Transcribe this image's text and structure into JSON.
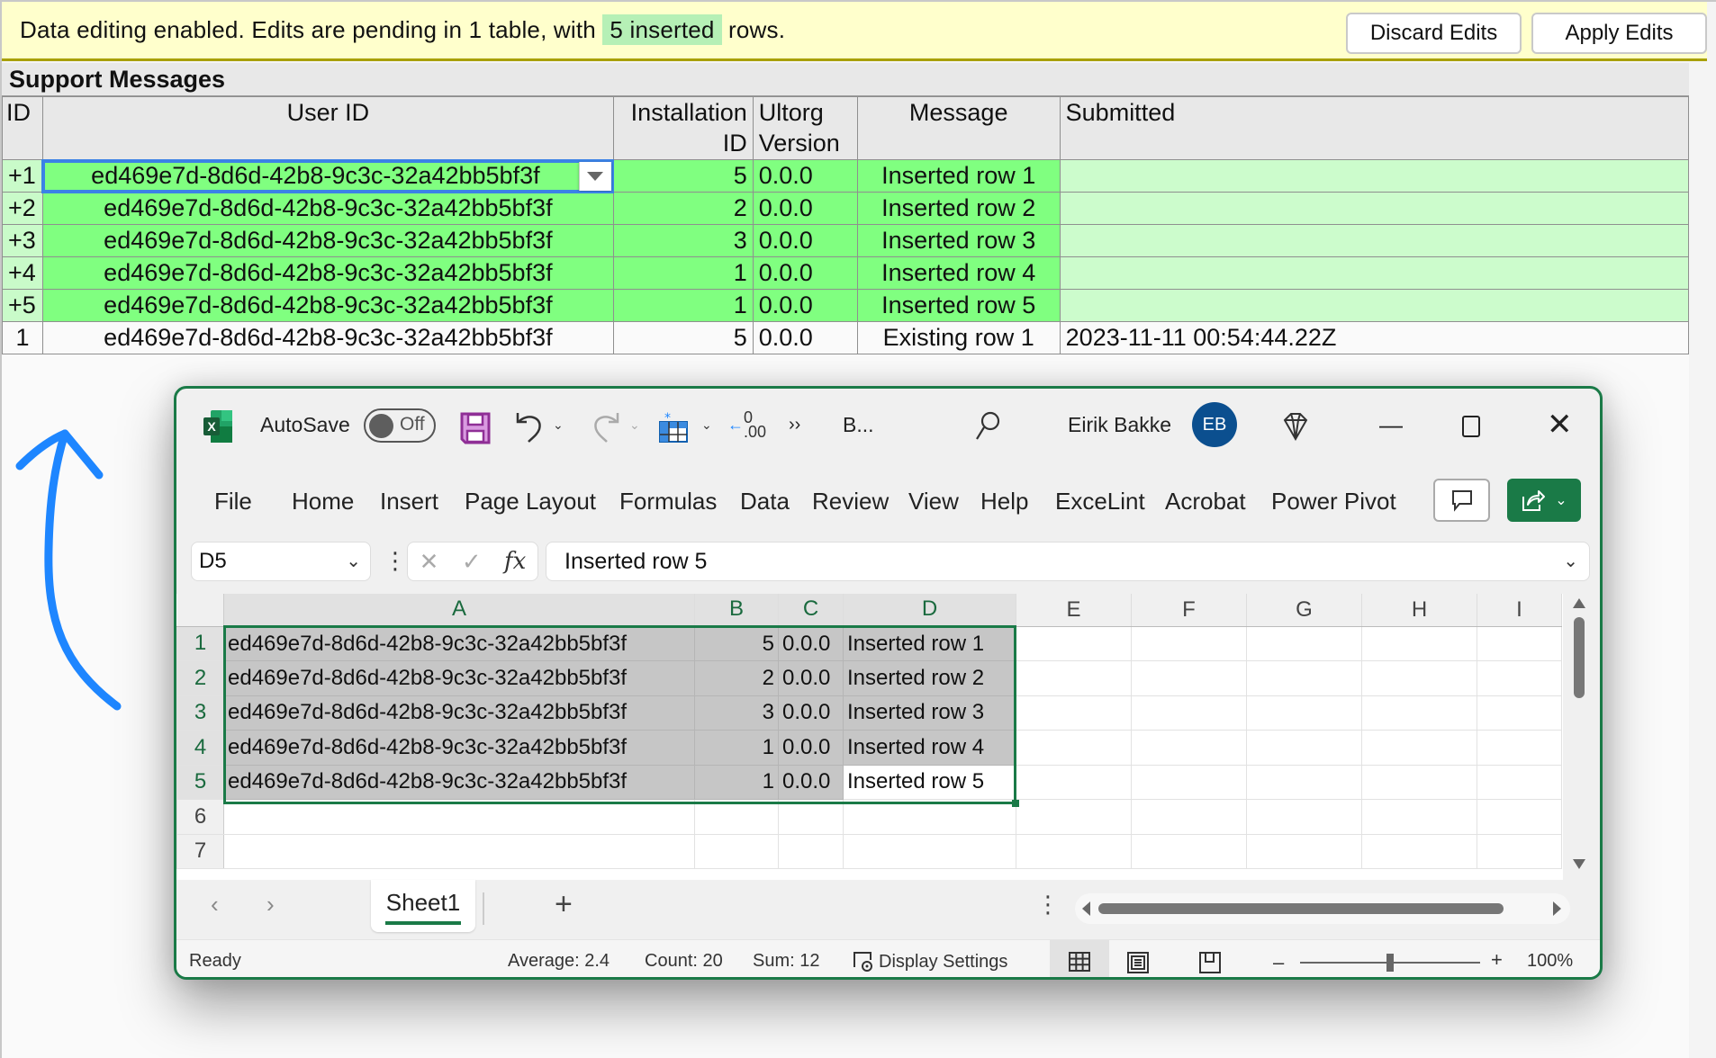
{
  "banner": {
    "text_before": "Data editing enabled. Edits are pending in 1 table, with",
    "badge": "5 inserted",
    "text_after": "rows.",
    "discard_label": "Discard Edits",
    "apply_label": "Apply Edits"
  },
  "table": {
    "title": "Support Messages",
    "headers": [
      "ID",
      "User ID",
      "Installation ID",
      "Ultorg Version",
      "Message",
      "Submitted"
    ],
    "header_lines": {
      "inst_1": "Installation",
      "inst_2": "ID",
      "ver_1": "Ultorg",
      "ver_2": "Version"
    },
    "rows": [
      {
        "id": "+1",
        "user_id": "ed469e7d-8d6d-42b8-9c3c-32a42bb5bf3f",
        "installation_id": "5",
        "version": "0.0.0",
        "message": "Inserted row 1",
        "submitted": "",
        "state": "inserted"
      },
      {
        "id": "+2",
        "user_id": "ed469e7d-8d6d-42b8-9c3c-32a42bb5bf3f",
        "installation_id": "2",
        "version": "0.0.0",
        "message": "Inserted row 2",
        "submitted": "",
        "state": "inserted"
      },
      {
        "id": "+3",
        "user_id": "ed469e7d-8d6d-42b8-9c3c-32a42bb5bf3f",
        "installation_id": "3",
        "version": "0.0.0",
        "message": "Inserted row 3",
        "submitted": "",
        "state": "inserted"
      },
      {
        "id": "+4",
        "user_id": "ed469e7d-8d6d-42b8-9c3c-32a42bb5bf3f",
        "installation_id": "1",
        "version": "0.0.0",
        "message": "Inserted row 4",
        "submitted": "",
        "state": "inserted"
      },
      {
        "id": "+5",
        "user_id": "ed469e7d-8d6d-42b8-9c3c-32a42bb5bf3f",
        "installation_id": "1",
        "version": "0.0.0",
        "message": "Inserted row 5",
        "submitted": "",
        "state": "inserted"
      },
      {
        "id": "1",
        "user_id": "ed469e7d-8d6d-42b8-9c3c-32a42bb5bf3f",
        "installation_id": "5",
        "version": "0.0.0",
        "message": "Existing row 1",
        "submitted": "2023-11-11 00:54:44.22Z",
        "state": "existing"
      }
    ]
  },
  "colors": {
    "banner_bg": "#ffffcc",
    "badge_bg": "#b6f0b6",
    "inserted_row": "#80ff80",
    "inserted_light": "#ccfccc",
    "selection_blue": "#3b82e6",
    "arrow_blue": "#1e86ff",
    "excel_green": "#1a7a47",
    "avatar_blue": "#0b4f8f"
  },
  "excel": {
    "autosave_label": "AutoSave",
    "autosave_state": "Off",
    "filename_truncated": "B...",
    "user_name": "Eirik Bakke",
    "user_initials": "EB",
    "menu": [
      "File",
      "Home",
      "Insert",
      "Page Layout",
      "Formulas",
      "Data",
      "Review",
      "View",
      "Help",
      "ExceLint",
      "Acrobat",
      "Power Pivot"
    ],
    "name_box": "D5",
    "formula": "Inserted row 5",
    "columns": [
      "A",
      "B",
      "C",
      "D",
      "E",
      "F",
      "G",
      "H",
      "I"
    ],
    "row_numbers": [
      "1",
      "2",
      "3",
      "4",
      "5",
      "6",
      "7"
    ],
    "cells": [
      [
        "ed469e7d-8d6d-42b8-9c3c-32a42bb5bf3f",
        "5",
        "0.0.0",
        "Inserted row 1"
      ],
      [
        "ed469e7d-8d6d-42b8-9c3c-32a42bb5bf3f",
        "2",
        "0.0.0",
        "Inserted row 2"
      ],
      [
        "ed469e7d-8d6d-42b8-9c3c-32a42bb5bf3f",
        "3",
        "0.0.0",
        "Inserted row 3"
      ],
      [
        "ed469e7d-8d6d-42b8-9c3c-32a42bb5bf3f",
        "1",
        "0.0.0",
        "Inserted row 4"
      ],
      [
        "ed469e7d-8d6d-42b8-9c3c-32a42bb5bf3f",
        "1",
        "0.0.0",
        "Inserted row 5"
      ]
    ],
    "sheet_tab": "Sheet1",
    "status": {
      "ready": "Ready",
      "average": "Average: 2.4",
      "count": "Count: 20",
      "sum": "Sum: 12",
      "display_settings": "Display Settings",
      "zoom": "100%"
    }
  }
}
